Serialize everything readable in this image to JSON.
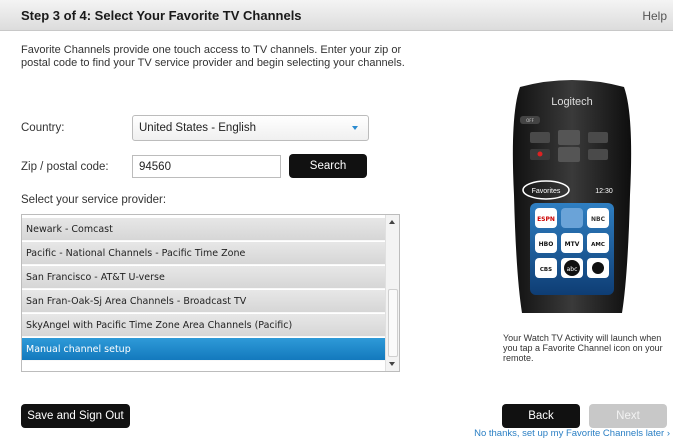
{
  "header": {
    "title": "Step 3 of 4: Select Your Favorite TV Channels",
    "help": "Help"
  },
  "intro": "Favorite Channels provide one touch access to TV channels. Enter your zip or postal code to find your TV service provider and begin selecting your channels.",
  "form": {
    "country_label": "Country:",
    "country_value": "United States - English",
    "zip_label": "Zip / postal code:",
    "zip_value": "94560",
    "search_label": "Search",
    "provider_label": "Select your service provider:"
  },
  "providers": [
    {
      "label": "Newark - Comcast",
      "selected": false
    },
    {
      "label": "Pacific - National Channels - Pacific Time Zone",
      "selected": false
    },
    {
      "label": "San Francisco - AT&T U-verse",
      "selected": false
    },
    {
      "label": "San Fran-Oak-Sj Area Channels - Broadcast TV",
      "selected": false
    },
    {
      "label": "SkyAngel with Pacific Time Zone Area Channels (Pacific)",
      "selected": false
    },
    {
      "label": "Manual channel setup",
      "selected": true
    }
  ],
  "remote": {
    "brand": "Logitech",
    "off_label": "OFF",
    "favorites_label": "Favorites",
    "time": "12:30",
    "channels": [
      "ESPN",
      "",
      "NBC",
      "HBO",
      "MTV",
      "AMC",
      "CBS",
      "abc",
      ""
    ]
  },
  "caption": "Your Watch TV Activity will launch when you tap a Favorite Channel icon on your remote.",
  "footer": {
    "save_label": "Save and Sign Out",
    "back_label": "Back",
    "next_label": "Next",
    "skip_link": "No thanks, set up my Favorite Channels later ›"
  }
}
